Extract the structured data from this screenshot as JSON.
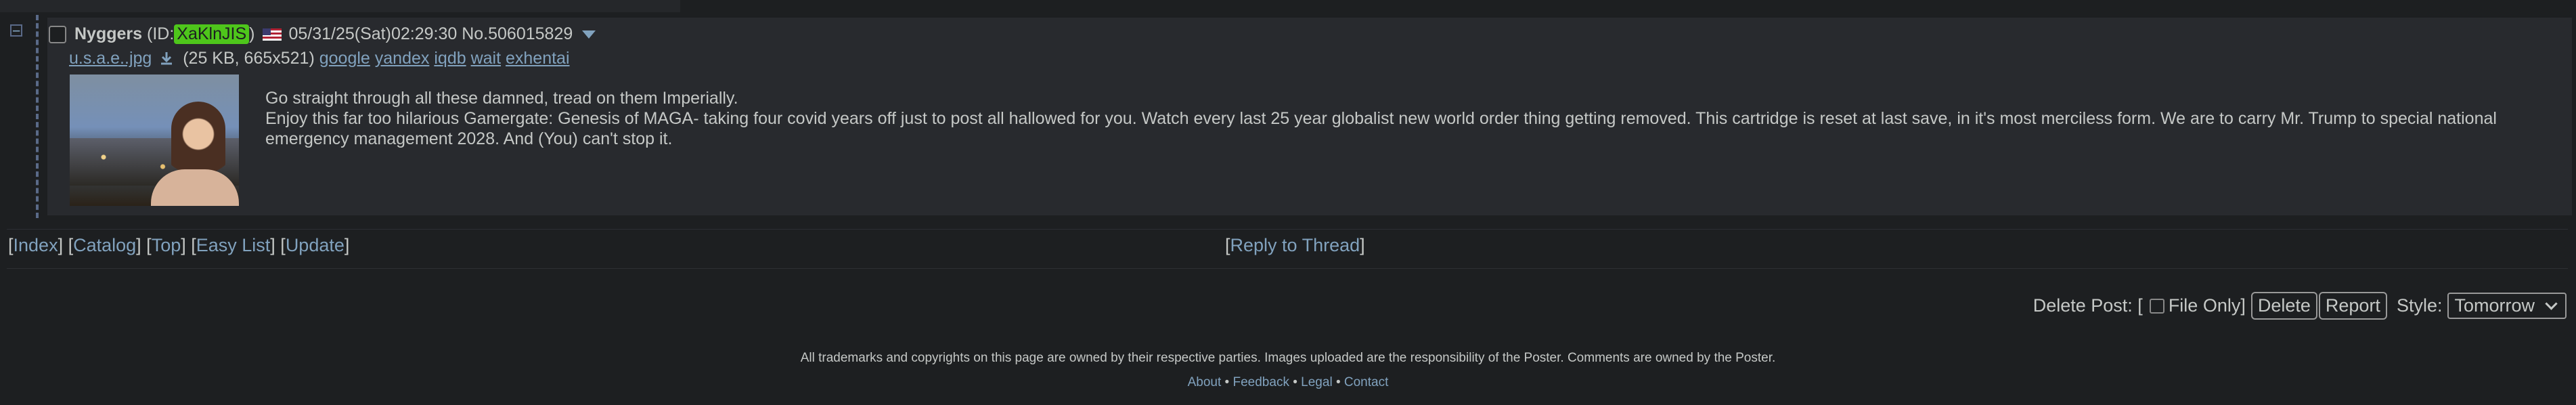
{
  "post": {
    "name": "Nyggers",
    "id_prefix": "(ID: ",
    "id_value": "XaKlnJIS",
    "id_suffix": ")",
    "datetime": "05/31/25(Sat)02:29:30",
    "number": "No.506015829",
    "file": {
      "filename": "u.s.a.e..jpg",
      "info": "(25 KB, 665x521)",
      "search_links": [
        "google",
        "yandex",
        "iqdb",
        "wait",
        "exhentai"
      ]
    },
    "message": [
      "Go straight through all these damned, tread on them Imperially.",
      "Enjoy this far too hilarious Gamergate: Genesis of MAGA- taking four covid years off just to post all hallowed for you. Watch every last 25 year globalist new world order thing getting removed. This cartridge is reset at last save, in it's most merciless form. We are to carry Mr. Trump to special national emergency management 2028. And (You) can't stop it."
    ]
  },
  "nav": {
    "index": "Index",
    "catalog": "Catalog",
    "top": "Top",
    "easy_list": "Easy List",
    "update": "Update",
    "reply": "Reply to Thread"
  },
  "delete_form": {
    "label": "Delete Post: [",
    "file_only": "File Only]",
    "delete": "Delete",
    "report": "Report",
    "style_label": "Style:",
    "style_value": "Tomorrow"
  },
  "footer": {
    "notice": "All trademarks and copyrights on this page are owned by their respective parties. Images uploaded are the responsibility of the Poster. Comments are owned by the Poster.",
    "about": "About",
    "feedback": "Feedback",
    "legal": "Legal",
    "contact": "Contact"
  },
  "colors": {
    "background": "#1d1f21",
    "reply_bg": "#282a2e",
    "link": "#81a2be",
    "id_highlight": "#4ec61b"
  }
}
